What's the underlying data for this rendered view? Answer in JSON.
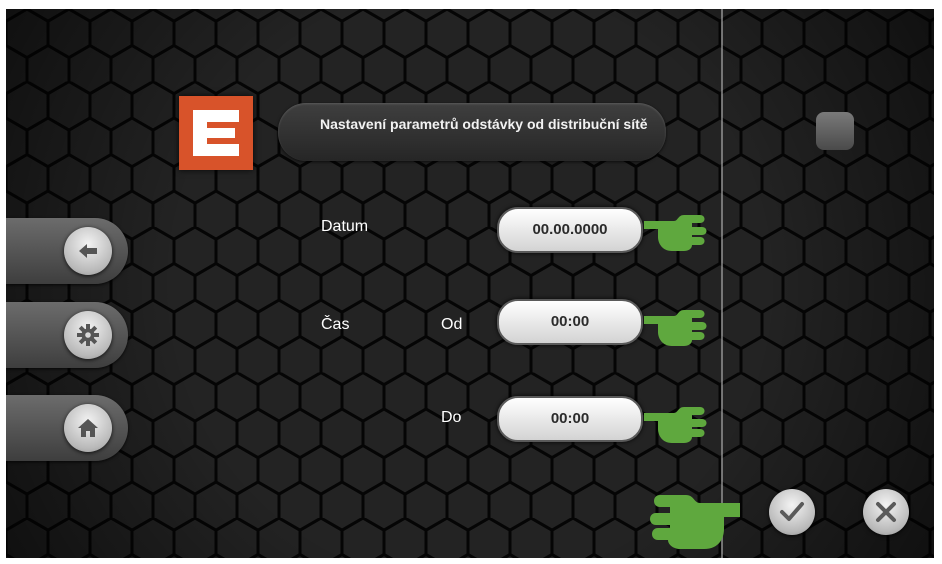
{
  "header": {
    "title": "Nastavení parametrů odstávky od distribuční sítě",
    "logo_icon": "cez-logo",
    "brand_color": "#d8532a"
  },
  "sidebar": {
    "items": [
      {
        "icon": "arrow-left-icon",
        "action": "back"
      },
      {
        "icon": "gear-icon",
        "action": "settings"
      },
      {
        "icon": "home-icon",
        "action": "home"
      }
    ]
  },
  "form": {
    "date_label": "Datum",
    "date_value": "00.00.0000",
    "time_label": "Čas",
    "from_label": "Od",
    "from_value": "00:00",
    "to_label": "Do",
    "to_value": "00:00"
  },
  "footer": {
    "confirm_icon": "checkmark-icon",
    "cancel_icon": "close-icon"
  },
  "annotations": {
    "pointer_icon": "pointing-hand-icon",
    "pointer_color": "#5fa83e"
  }
}
